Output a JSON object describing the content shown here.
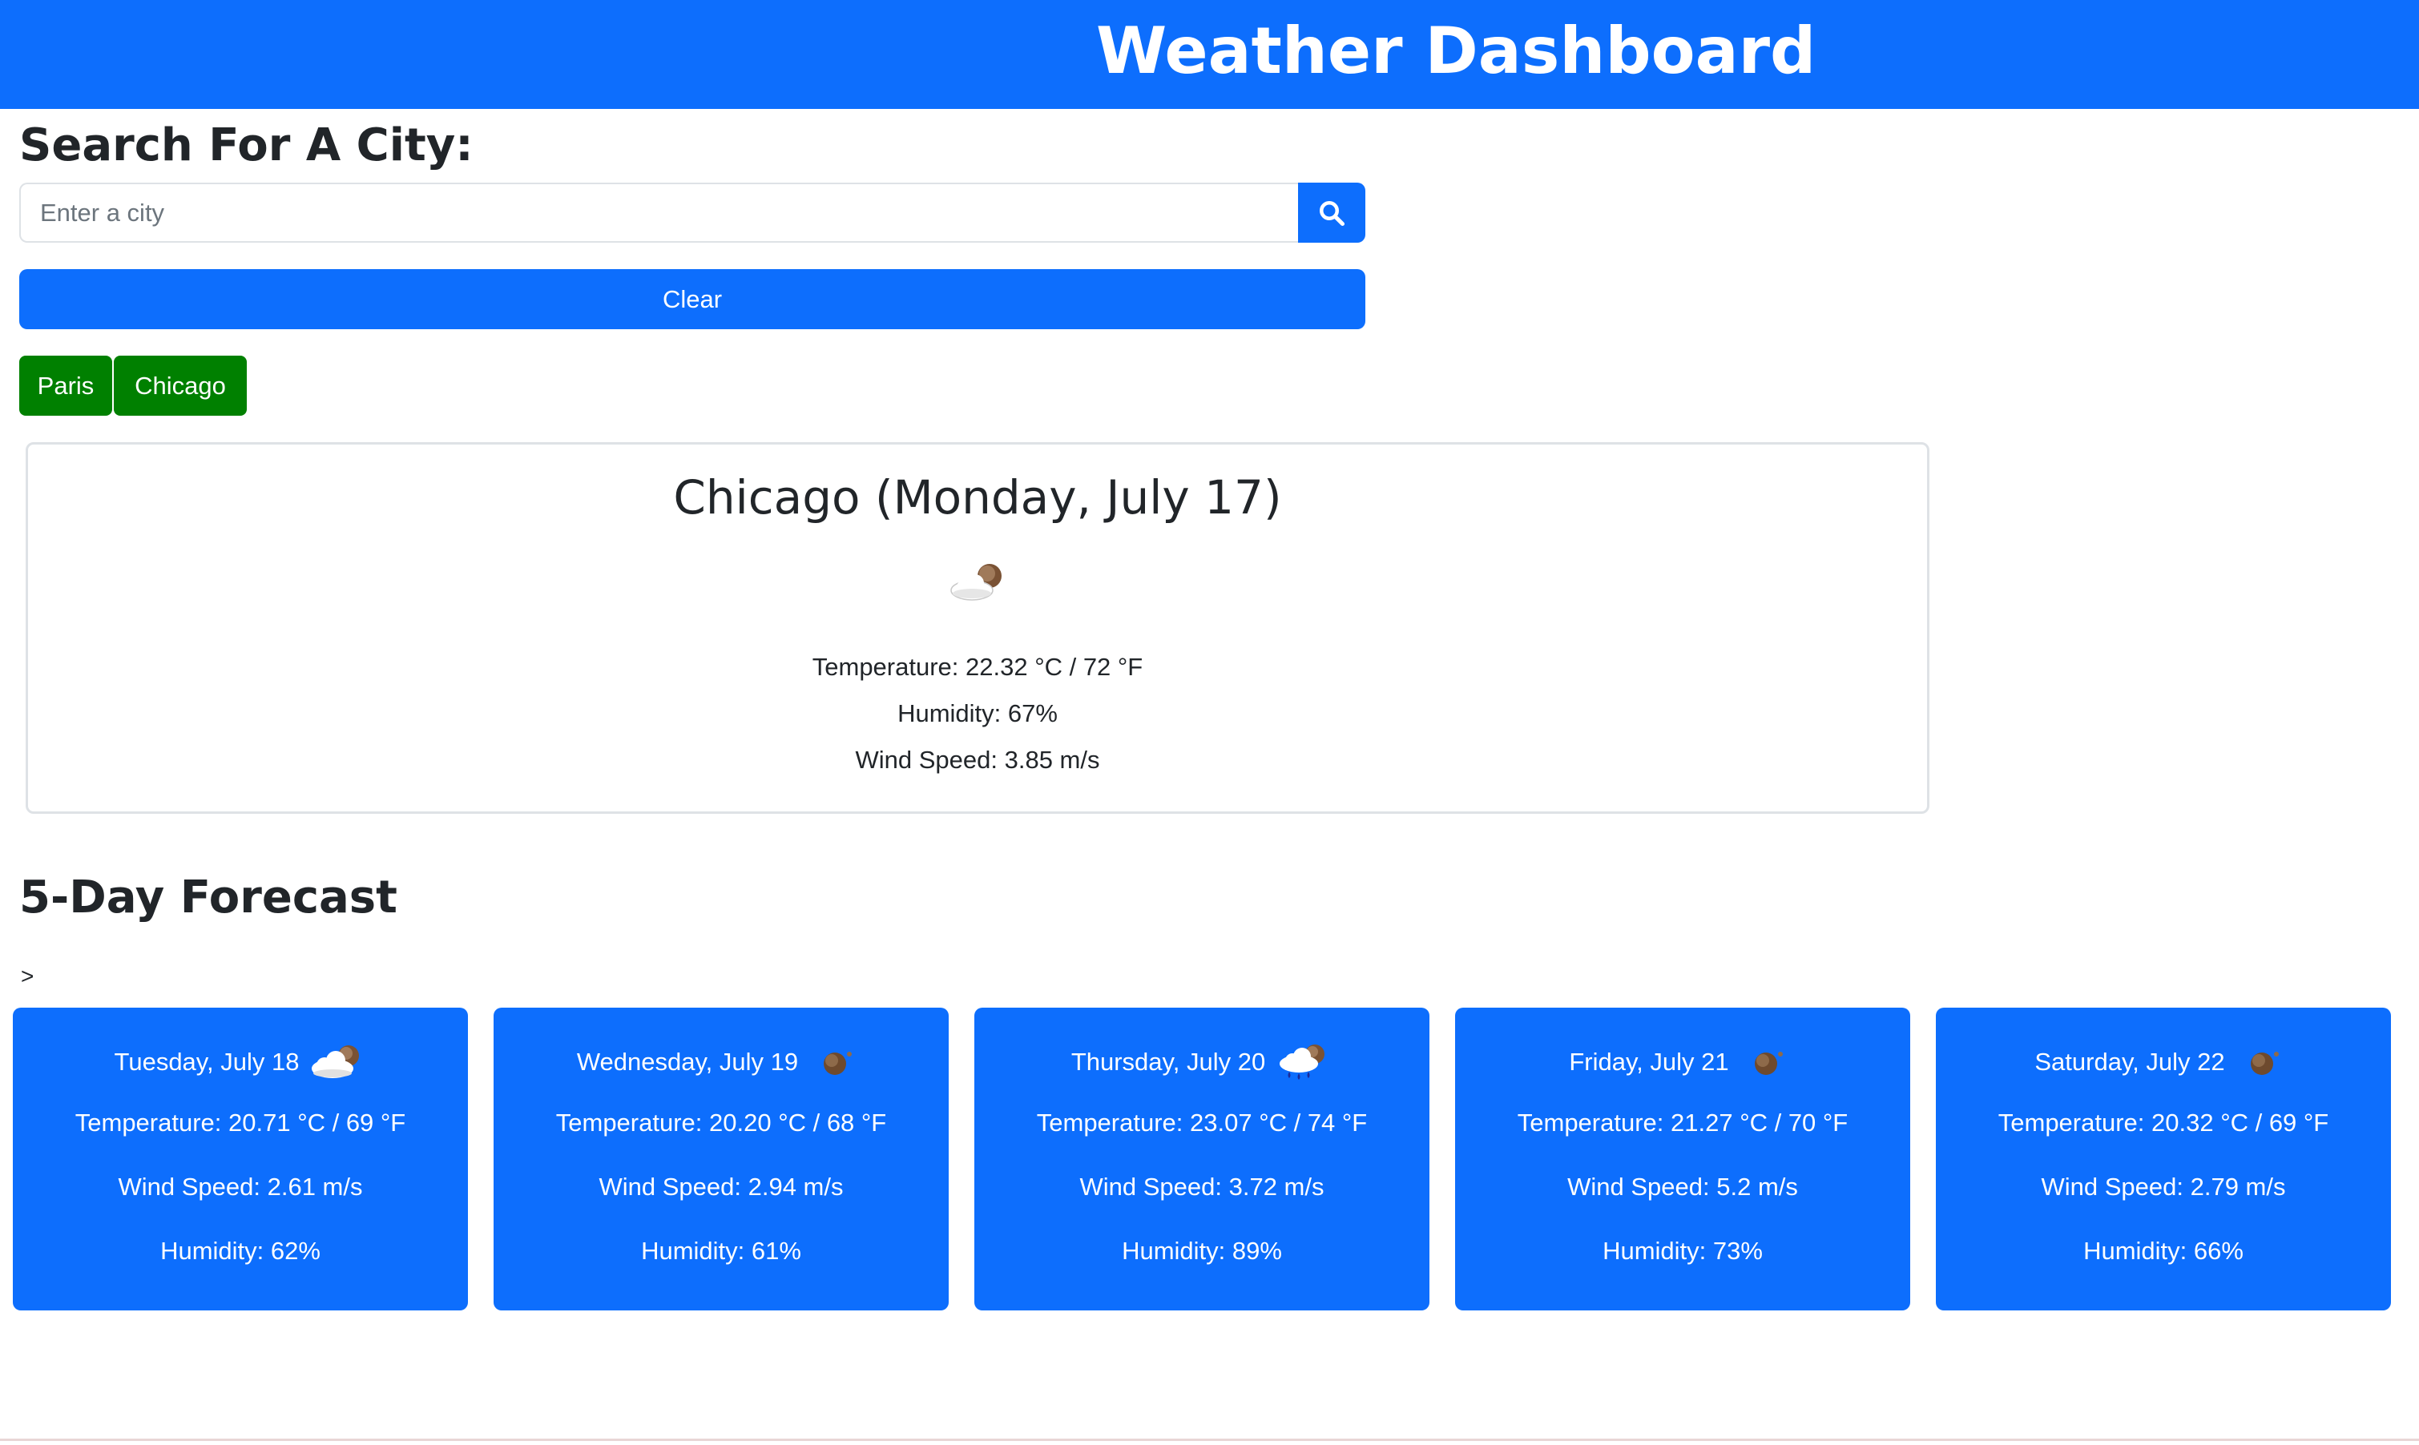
{
  "header": {
    "title": "Weather Dashboard"
  },
  "search": {
    "heading": "Search For A City:",
    "placeholder": "Enter a city",
    "value": "",
    "button_icon": "search-icon",
    "clear_label": "Clear"
  },
  "history": [
    "Paris",
    "Chicago"
  ],
  "current": {
    "title": "Chicago (Monday, July 17)",
    "icon": "partly-cloudy-night-icon",
    "temperature": "Temperature: 22.32 °C / 72 °F",
    "humidity": "Humidity: 67%",
    "wind": "Wind Speed: 3.85 m/s"
  },
  "forecast": {
    "heading": "5-Day Forecast",
    "marker": ">",
    "days": [
      {
        "date": "Tuesday, July 18",
        "icon": "cloudy-night-icon",
        "temperature": "Temperature: 20.71 °C / 69 °F",
        "wind": "Wind Speed: 2.61 m/s",
        "humidity": "Humidity: 62%"
      },
      {
        "date": "Wednesday, July 19",
        "icon": "clear-night-icon",
        "temperature": "Temperature: 20.20 °C / 68 °F",
        "wind": "Wind Speed: 2.94 m/s",
        "humidity": "Humidity: 61%"
      },
      {
        "date": "Thursday, July 20",
        "icon": "rain-night-icon",
        "temperature": "Temperature: 23.07 °C / 74 °F",
        "wind": "Wind Speed: 3.72 m/s",
        "humidity": "Humidity: 89%"
      },
      {
        "date": "Friday, July 21",
        "icon": "clear-night-icon",
        "temperature": "Temperature: 21.27 °C / 70 °F",
        "wind": "Wind Speed: 5.2 m/s",
        "humidity": "Humidity: 73%"
      },
      {
        "date": "Saturday, July 22",
        "icon": "clear-night-icon",
        "temperature": "Temperature: 20.32 °C / 69 °F",
        "wind": "Wind Speed: 2.79 m/s",
        "humidity": "Humidity: 66%"
      }
    ]
  },
  "colors": {
    "primary": "#0d6efd",
    "history_button": "#008000",
    "text": "#212529",
    "card_border": "#dee2e6"
  }
}
